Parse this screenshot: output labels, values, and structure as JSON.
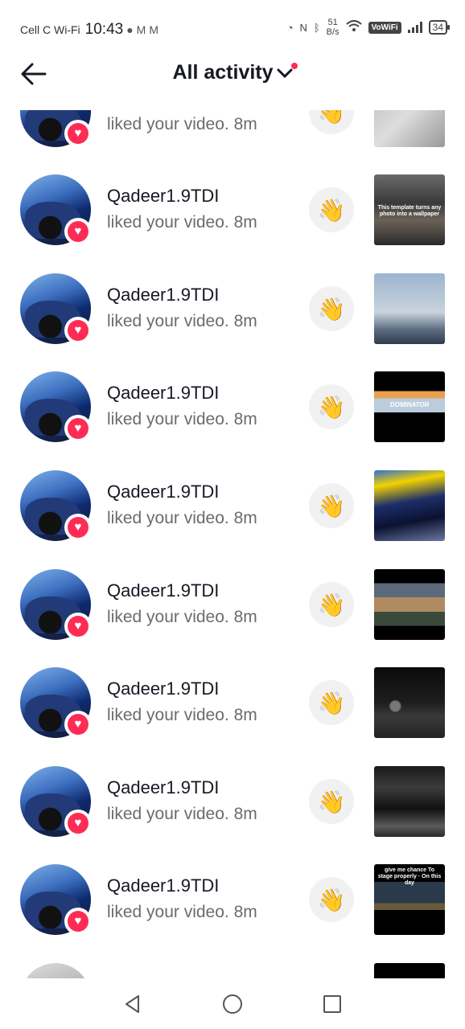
{
  "status_bar": {
    "carrier": "Cell C Wi-Fi",
    "time": "10:43",
    "speed_value": "51",
    "speed_unit": "B/s",
    "vowifi": "VoWiFi",
    "battery": "34"
  },
  "header": {
    "title": "All activity"
  },
  "items": [
    {
      "name": "",
      "action": "liked your video. 8m",
      "thumb": "thumb-grey-blurry"
    },
    {
      "name": "Qadeer1.9TDI",
      "action": "liked your video. 8m",
      "thumb": "thumb-garage",
      "caption": "This template turns any photo into a wallpaper"
    },
    {
      "name": "Qadeer1.9TDI",
      "action": "liked your video. 8m",
      "thumb": "thumb-sky"
    },
    {
      "name": "Qadeer1.9TDI",
      "action": "liked your video. 8m",
      "thumb": "thumb-dominator",
      "caption": "DOMINATOR"
    },
    {
      "name": "Qadeer1.9TDI",
      "action": "liked your video. 8m",
      "thumb": "thumb-car-trees"
    },
    {
      "name": "Qadeer1.9TDI",
      "action": "liked your video. 8m",
      "thumb": "thumb-explosion"
    },
    {
      "name": "Qadeer1.9TDI",
      "action": "liked your video. 8m",
      "thumb": "thumb-night-car"
    },
    {
      "name": "Qadeer1.9TDI",
      "action": "liked your video. 8m",
      "thumb": "thumb-parked-car"
    },
    {
      "name": "Qadeer1.9TDI",
      "action": "liked your video. 8m",
      "thumb": "thumb-stage",
      "caption": "give me chance To stage properly · On this day"
    }
  ],
  "colors": {
    "accent": "#fe2c55",
    "text": "#161823",
    "secondary": "#6b6b70"
  }
}
